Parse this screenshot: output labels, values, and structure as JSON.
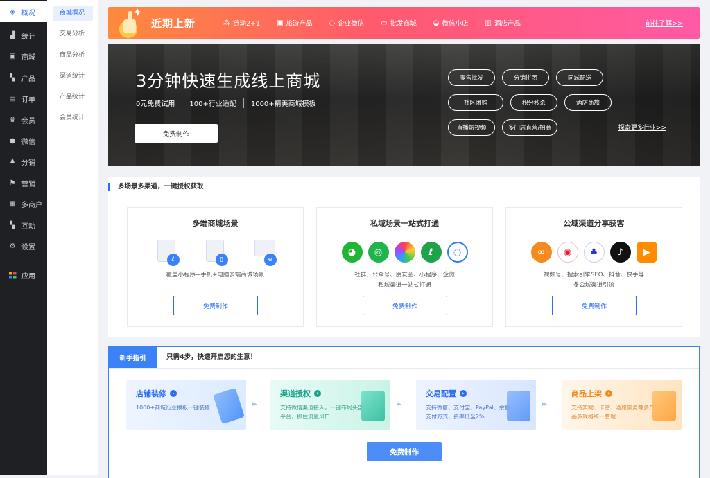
{
  "sidebar": {
    "items": [
      {
        "label": "概况",
        "icon": "layers-icon"
      },
      {
        "label": "统计",
        "icon": "chart-icon"
      },
      {
        "label": "商城",
        "icon": "store-icon"
      },
      {
        "label": "产品",
        "icon": "grid-icon"
      },
      {
        "label": "订单",
        "icon": "clipboard-icon"
      },
      {
        "label": "会员",
        "icon": "crown-icon"
      },
      {
        "label": "微信",
        "icon": "wechat-icon"
      },
      {
        "label": "分销",
        "icon": "users-icon"
      },
      {
        "label": "营销",
        "icon": "flag-icon"
      },
      {
        "label": "多商户",
        "icon": "shop-icon"
      },
      {
        "label": "互动",
        "icon": "apps-icon"
      },
      {
        "label": "设置",
        "icon": "gear-icon"
      },
      {
        "label": "应用",
        "icon": "app-grid-icon"
      }
    ]
  },
  "subnav": {
    "items": [
      "商城概况",
      "交易分析",
      "商品分析",
      "渠道统计",
      "产品统计",
      "会员统计"
    ]
  },
  "top_banner": {
    "title": "近期上新",
    "links": [
      {
        "label": "链动2+1",
        "icon": "share-icon"
      },
      {
        "label": "旅游产品",
        "icon": "suitcase-icon"
      },
      {
        "label": "企业微信",
        "icon": "chat-icon"
      },
      {
        "label": "批发商城",
        "icon": "cart-icon"
      },
      {
        "label": "微信小店",
        "icon": "store-icon"
      },
      {
        "label": "酒店产品",
        "icon": "building-icon"
      }
    ],
    "more": "前往了解>>"
  },
  "hero": {
    "title": "3分钟快速生成线上商城",
    "features": [
      "0元免费试用",
      "100+行业适配",
      "1000+精美商城模板"
    ],
    "button": "免费制作",
    "tags": [
      "零售批发",
      "分销拼团",
      "同城配送",
      "社区团购",
      "积分秒杀",
      "酒店商旅",
      "直播短视频",
      "多门店直营/招商"
    ],
    "explore": "探索更多行业>>"
  },
  "multi_channel": {
    "title": "多场景多渠道，一键授权获取",
    "cards": [
      {
        "title": "多端商城场景",
        "desc": [
          "覆盖小程序+手机+电脑多端商城场景"
        ],
        "button": "免费制作"
      },
      {
        "title": "私域场景一站式打通",
        "desc": [
          "社群、公众号、朋友圈、小程序、企微",
          "私域渠道一站式打通"
        ],
        "button": "免费制作"
      },
      {
        "title": "公域渠道分享获客",
        "desc": [
          "视频号、搜索引擎SEO、抖音、快手等",
          "多公域渠道引流"
        ],
        "button": "免费制作"
      }
    ]
  },
  "guide": {
    "tab": "新手指引",
    "heading": "只需4步，快速开启您的生意！",
    "steps": [
      {
        "title": "店铺装修",
        "desc": "1000+商城行业模板一键装修",
        "color": "#2c6ef2"
      },
      {
        "title": "渠道授权",
        "desc": "支持微信渠道接入，一键布局头部平台，抓住流量风口",
        "color": "#1aa38a"
      },
      {
        "title": "交易配置",
        "desc": "支持微信、支付宝、PayPal、余额支付方式，费率低至2%",
        "color": "#2c6ef2"
      },
      {
        "title": "商品上架",
        "desc": "支持实物、卡密、酒旅票务等多产品多规格统一管理",
        "color": "#f28a1c"
      }
    ],
    "button": "免费制作"
  }
}
